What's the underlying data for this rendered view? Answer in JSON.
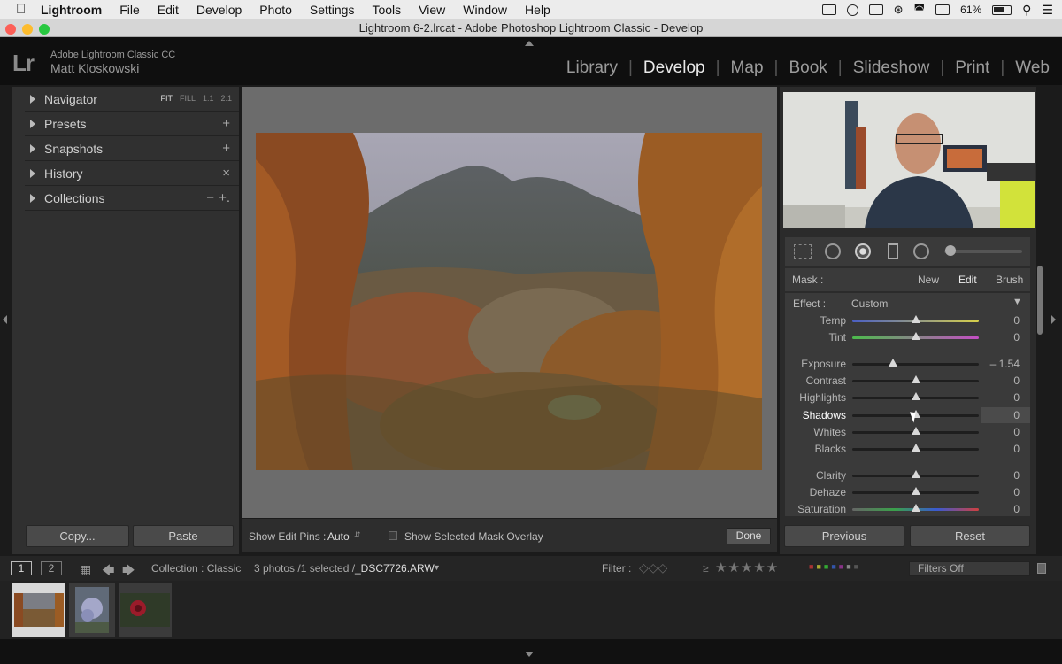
{
  "menubar": {
    "app": "Lightroom",
    "items": [
      "File",
      "Edit",
      "Develop",
      "Photo",
      "Settings",
      "Tools",
      "View",
      "Window",
      "Help"
    ],
    "battery": "61%"
  },
  "window": {
    "title": "Lightroom 6-2.lrcat - Adobe Photoshop Lightroom Classic - Develop"
  },
  "identity": {
    "logo": "Lr",
    "product": "Adobe Lightroom Classic CC",
    "user": "Matt Kloskowski"
  },
  "modules": [
    "Library",
    "Develop",
    "Map",
    "Book",
    "Slideshow",
    "Print",
    "Web"
  ],
  "left_panel": {
    "navigator": {
      "label": "Navigator",
      "zoom_options": [
        "FIT",
        "FILL",
        "1:1",
        "2:1"
      ]
    },
    "presets": {
      "label": "Presets",
      "action": "+"
    },
    "snapshots": {
      "label": "Snapshots",
      "action": "+"
    },
    "history": {
      "label": "History",
      "action": "×"
    },
    "collections": {
      "label": "Collections",
      "action_minus": "−",
      "action_plus": "+."
    },
    "copy_label": "Copy...",
    "paste_label": "Paste"
  },
  "toolbar": {
    "edit_pins_label": "Show Edit Pins :",
    "edit_pins_value": "Auto",
    "mask_overlay_label": "Show Selected Mask Overlay",
    "done_label": "Done"
  },
  "mask": {
    "label": "Mask :",
    "new": "New",
    "edit": "Edit",
    "brush": "Brush"
  },
  "effect": {
    "label": "Effect :",
    "value": "Custom"
  },
  "sliders": [
    {
      "label": "Temp",
      "value": "0",
      "pos": 0.5
    },
    {
      "label": "Tint",
      "value": "0",
      "pos": 0.5
    },
    {
      "label": "Exposure",
      "value": "– 1.54",
      "pos": 0.32
    },
    {
      "label": "Contrast",
      "value": "0",
      "pos": 0.5
    },
    {
      "label": "Highlights",
      "value": "0",
      "pos": 0.5
    },
    {
      "label": "Shadows",
      "value": "0",
      "pos": 0.5
    },
    {
      "label": "Whites",
      "value": "0",
      "pos": 0.5
    },
    {
      "label": "Blacks",
      "value": "0",
      "pos": 0.5
    },
    {
      "label": "Clarity",
      "value": "0",
      "pos": 0.5
    },
    {
      "label": "Dehaze",
      "value": "0",
      "pos": 0.5
    },
    {
      "label": "Saturation",
      "value": "0",
      "pos": 0.5
    }
  ],
  "right_buttons": {
    "previous": "Previous",
    "reset": "Reset"
  },
  "filmstrip_bar": {
    "page1": "1",
    "page2": "2",
    "collection": "Collection : Classic",
    "count": "3 photos /1 selected /",
    "filename": "_DSC7726.ARW",
    "filter_label": "Filter :",
    "filters_off": "Filters Off"
  }
}
